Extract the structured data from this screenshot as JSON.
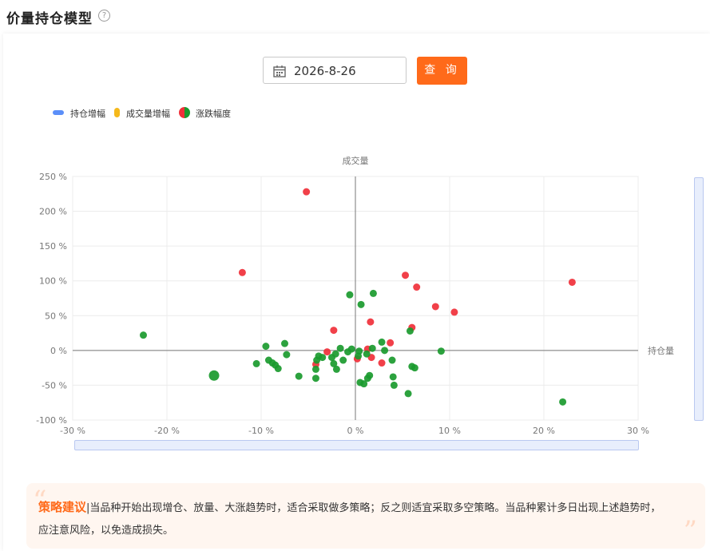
{
  "page": {
    "title": "价量持仓模型",
    "help_icon": "?"
  },
  "query": {
    "date": "2026-8-26",
    "button_label": "查 询"
  },
  "legend": {
    "items": [
      {
        "label": "持仓增幅",
        "color": "#5b8ff9",
        "icon": "bar-swatch"
      },
      {
        "label": "成交量增幅",
        "color": "#f5b91c",
        "icon": "bar-swatch"
      },
      {
        "label": "涨跌幅度",
        "color": "#f0303a/#1a9a2e",
        "icon": "circle-swatch"
      }
    ]
  },
  "chart_data": {
    "type": "scatter",
    "xlabel": "持仓量",
    "ylabel": "成交量",
    "xlim": [
      -30,
      30
    ],
    "ylim": [
      -100,
      250
    ],
    "xticks": [
      -30,
      -20,
      -10,
      0,
      10,
      20,
      30
    ],
    "yticks": [
      -100,
      -50,
      0,
      50,
      100,
      150,
      200,
      250
    ],
    "x_tick_labels": [
      "-30 %",
      "-20 %",
      "-10 %",
      "0 %",
      "10 %",
      "20 %",
      "30 %"
    ],
    "y_tick_labels": [
      "-100 %",
      "-50 %",
      "0 %",
      "50 %",
      "100 %",
      "150 %",
      "200 %",
      "250 %"
    ],
    "grid": true,
    "series": [
      {
        "name": "涨",
        "color": "#f0303a",
        "points": [
          [
            -5.2,
            228
          ],
          [
            -12,
            112
          ],
          [
            23,
            98
          ],
          [
            5.3,
            108
          ],
          [
            6.5,
            91
          ],
          [
            8.5,
            63
          ],
          [
            10.5,
            55
          ],
          [
            1.6,
            41
          ],
          [
            6,
            33
          ],
          [
            -2.3,
            29
          ],
          [
            3.7,
            11
          ],
          [
            -3,
            -2
          ],
          [
            -4.2,
            -20
          ],
          [
            1.3,
            2
          ],
          [
            0.2,
            -12
          ],
          [
            1.7,
            -10
          ],
          [
            2.8,
            -18
          ]
        ]
      },
      {
        "name": "跌",
        "color": "#1a9a2e",
        "points": [
          [
            -22.5,
            22
          ],
          [
            -15,
            -36
          ],
          [
            -9.5,
            6
          ],
          [
            -7.5,
            10
          ],
          [
            -7.3,
            -6
          ],
          [
            -10.5,
            -19
          ],
          [
            -9.2,
            -14
          ],
          [
            -8.8,
            -18
          ],
          [
            -8.5,
            -21
          ],
          [
            -8.2,
            -26
          ],
          [
            -6,
            -37
          ],
          [
            -4.2,
            -27
          ],
          [
            -4.1,
            -14
          ],
          [
            -3.9,
            -8
          ],
          [
            -3.5,
            -10
          ],
          [
            -4.2,
            -40
          ],
          [
            -2.5,
            -10
          ],
          [
            -2.1,
            -5
          ],
          [
            -2.3,
            -19
          ],
          [
            -2,
            -27
          ],
          [
            -1.6,
            3
          ],
          [
            -1.3,
            -14
          ],
          [
            -0.8,
            -2
          ],
          [
            -0.6,
            80
          ],
          [
            -0.4,
            2
          ],
          [
            0.4,
            -1
          ],
          [
            0.3,
            -8
          ],
          [
            0.5,
            -46
          ],
          [
            0.9,
            -48
          ],
          [
            0.6,
            66
          ],
          [
            1.5,
            -36
          ],
          [
            1.3,
            -40
          ],
          [
            1.2,
            -5
          ],
          [
            1.8,
            3
          ],
          [
            1.9,
            82
          ],
          [
            2.8,
            12
          ],
          [
            3.1,
            0
          ],
          [
            3.9,
            -14
          ],
          [
            4,
            -38
          ],
          [
            4.1,
            -50
          ],
          [
            5.6,
            -62
          ],
          [
            5.8,
            28
          ],
          [
            6,
            -23
          ],
          [
            6.3,
            -25
          ],
          [
            9.1,
            -1
          ],
          [
            22,
            -74
          ]
        ]
      }
    ]
  },
  "strategy": {
    "heading": "策略建议",
    "text": "|当品种开始出现增仓、放量、大涨趋势时，适合采取做多策略；反之则适宜采取多空策略。当品种累计多日出现上述趋势时，应注意风险，以免造成损失。"
  }
}
